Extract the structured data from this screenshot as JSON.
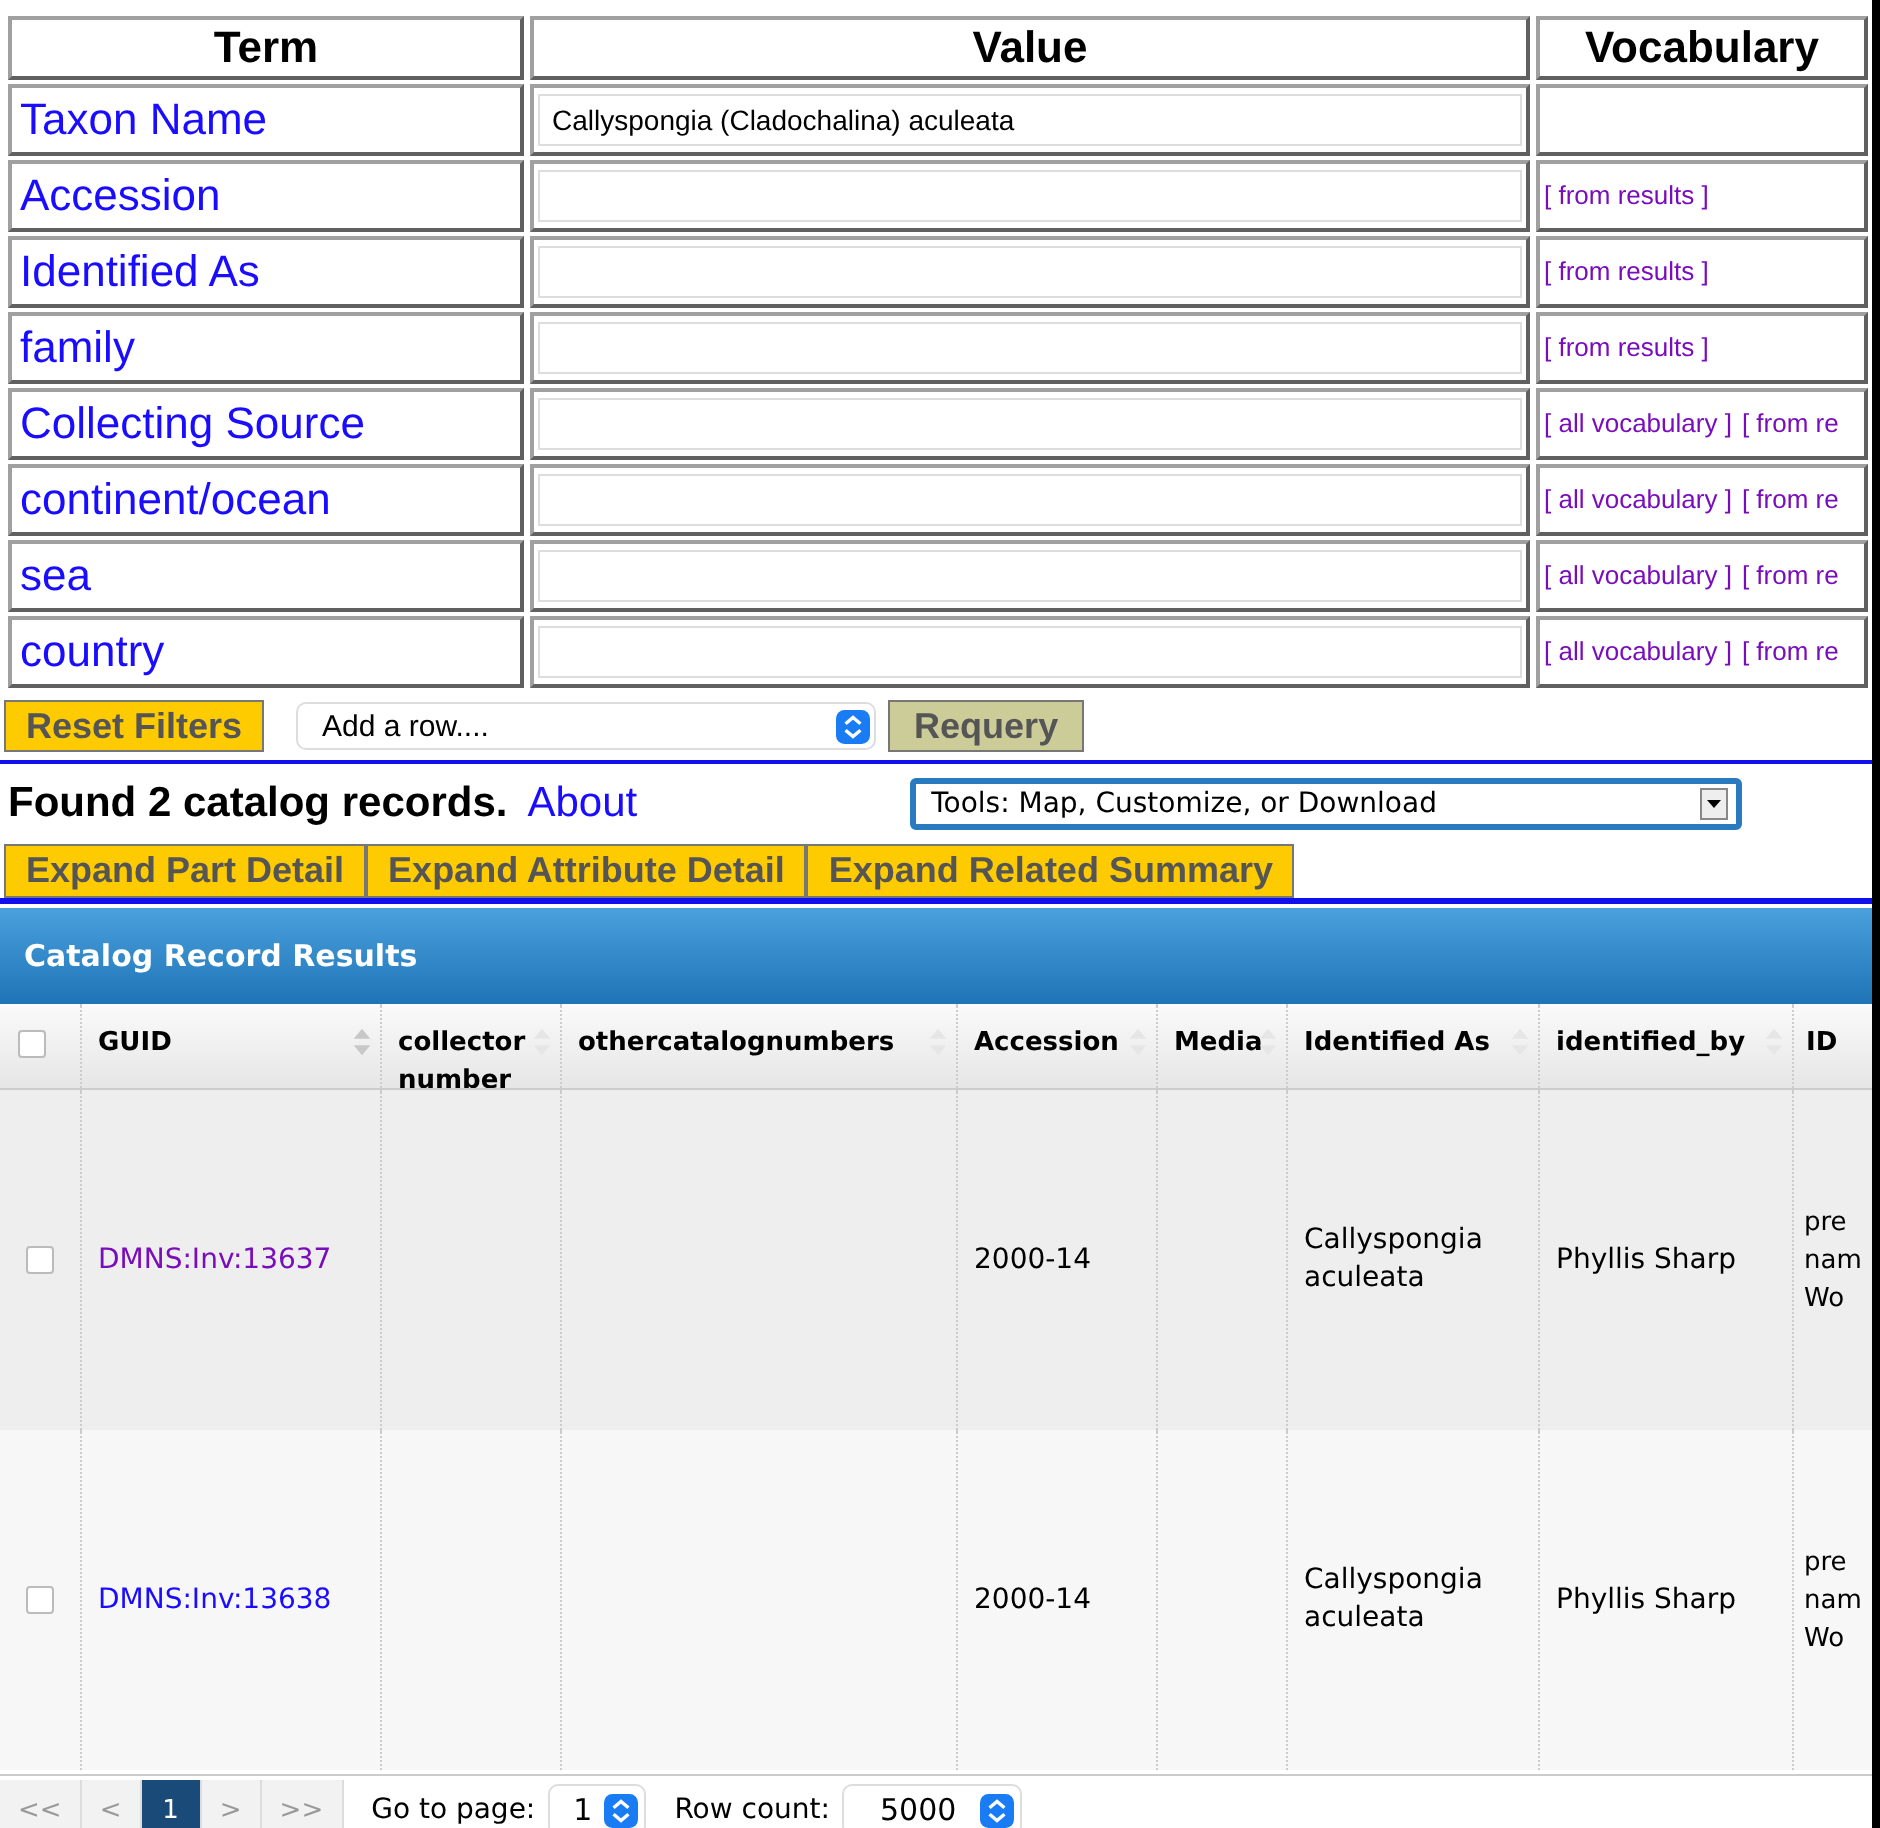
{
  "search_table": {
    "columns": [
      "Term",
      "Value",
      "Vocabulary"
    ],
    "rows": [
      {
        "term": "Taxon Name",
        "value": "Callyspongia (Cladochalina) aculeata",
        "vocabulary": []
      },
      {
        "term": "Accession",
        "value": "",
        "vocabulary": [
          "[ from results ]"
        ]
      },
      {
        "term": "Identified As",
        "value": "",
        "vocabulary": [
          "[ from results ]"
        ]
      },
      {
        "term": "family",
        "value": "",
        "vocabulary": [
          "[ from results ]"
        ]
      },
      {
        "term": "Collecting Source",
        "value": "",
        "vocabulary": [
          "[ all vocabulary ]",
          "[ from re"
        ]
      },
      {
        "term": "continent/ocean",
        "value": "",
        "vocabulary": [
          "[ all vocabulary ]",
          "[ from re"
        ]
      },
      {
        "term": "sea",
        "value": "",
        "vocabulary": [
          "[ all vocabulary ]",
          "[ from re"
        ]
      },
      {
        "term": "country",
        "value": "",
        "vocabulary": [
          "[ all vocabulary ]",
          "[ from re"
        ]
      }
    ]
  },
  "controls": {
    "reset": "Reset Filters",
    "add_row": "Add a row....",
    "requery": "Requery"
  },
  "summary": {
    "found": "Found 2 catalog records.",
    "about": "About",
    "tools": "Tools: Map, Customize, or Download"
  },
  "expand_buttons": [
    "Expand Part Detail",
    "Expand Attribute Detail",
    "Expand Related Summary"
  ],
  "grid": {
    "title": "Catalog Record Results",
    "all_checked": false,
    "columns": [
      "GUID",
      "collector number",
      "othercatalognumbers",
      "Accession",
      "Media",
      "Identified As",
      "identified_by",
      "ID"
    ],
    "rows": [
      {
        "checked": false,
        "visited": true,
        "cells": [
          "DMNS:Inv:13637",
          "",
          "",
          "2000-14",
          "",
          "Callyspongia aculeata",
          "Phyllis Sharp",
          "pre nam Wo"
        ]
      },
      {
        "checked": false,
        "visited": false,
        "cells": [
          "DMNS:Inv:13638",
          "",
          "",
          "2000-14",
          "",
          "Callyspongia aculeata",
          "Phyllis Sharp",
          "pre nam Wo"
        ]
      }
    ]
  },
  "pager": {
    "buttons": [
      {
        "label": "<<",
        "selected": false
      },
      {
        "label": "<",
        "selected": false
      },
      {
        "label": "1",
        "selected": true
      },
      {
        "label": ">",
        "selected": false
      },
      {
        "label": ">>",
        "selected": false
      }
    ],
    "goto_label": "Go to page:",
    "goto_value": "1",
    "rowcount_label": "Row count:",
    "rowcount_value": "5000"
  }
}
